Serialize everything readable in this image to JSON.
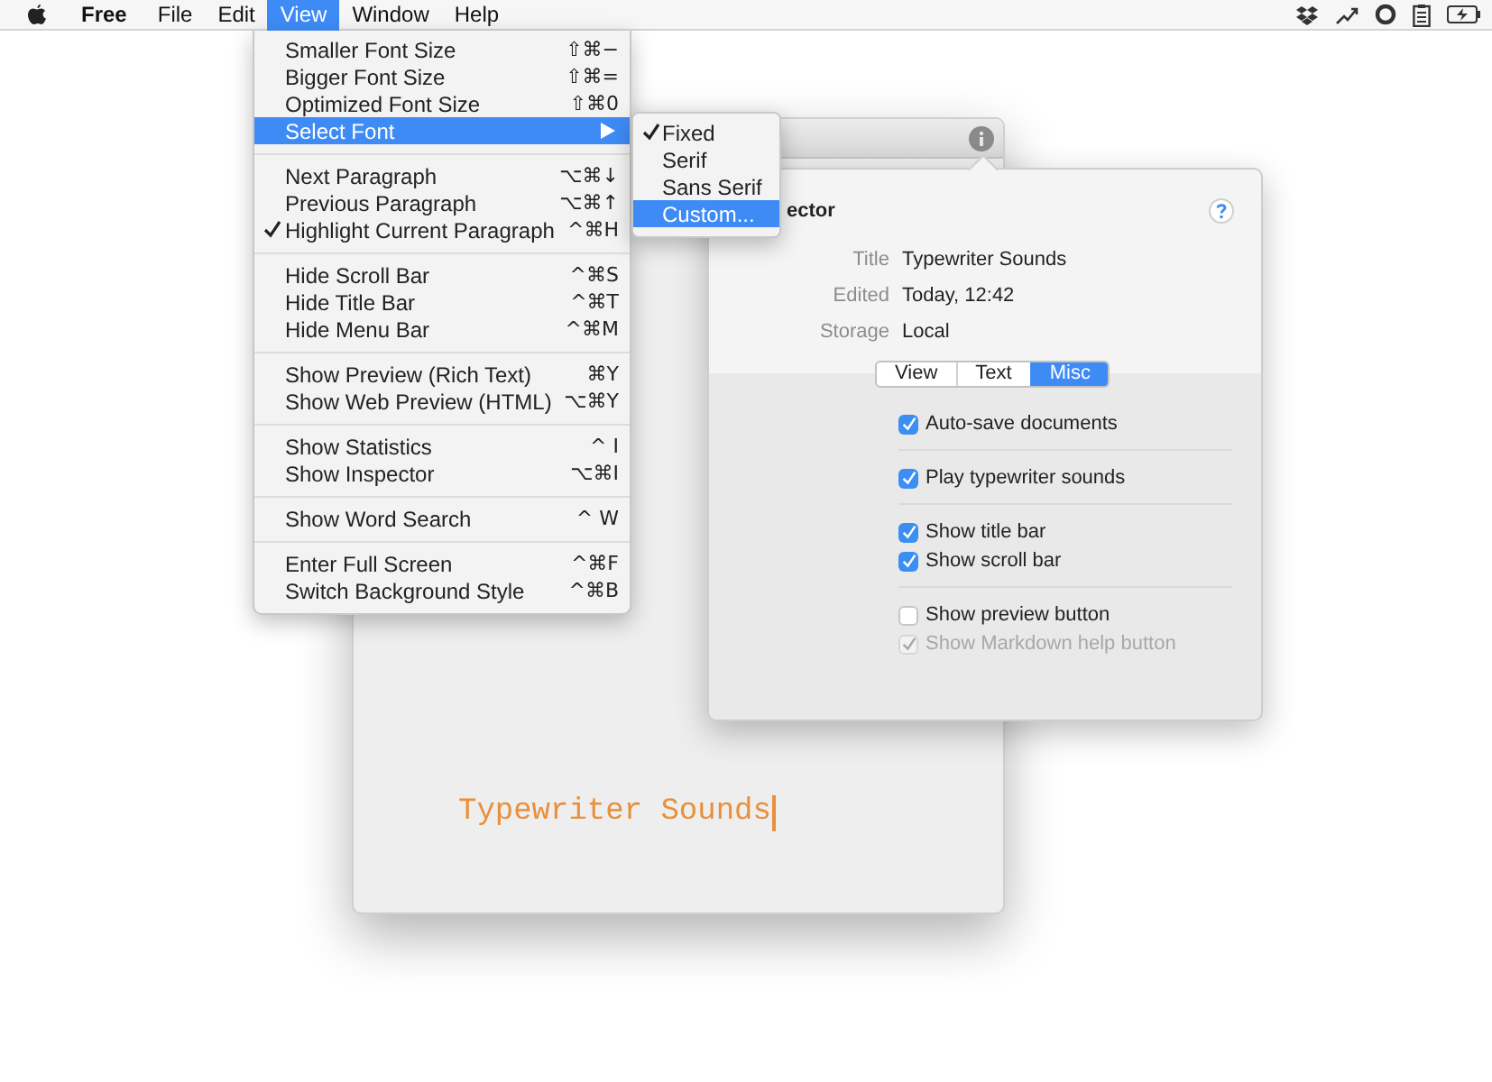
{
  "menu_bar": {
    "items": [
      {
        "label": "Free",
        "kind": "app",
        "selected": false
      },
      {
        "label": "File",
        "kind": "menu",
        "selected": false
      },
      {
        "label": "Edit",
        "kind": "menu",
        "selected": false
      },
      {
        "label": "View",
        "kind": "menu",
        "selected": true
      },
      {
        "label": "Window",
        "kind": "menu",
        "selected": false
      },
      {
        "label": "Help",
        "kind": "menu",
        "selected": false
      }
    ]
  },
  "view_menu": {
    "groups": [
      {
        "items": [
          {
            "label": "Smaller Font Size",
            "shortcut": "⇧⌘−",
            "checked": false,
            "selected": false
          },
          {
            "label": "Bigger Font Size",
            "shortcut": "⇧⌘=",
            "checked": false,
            "selected": false
          },
          {
            "label": "Optimized Font Size",
            "shortcut": "⇧⌘0",
            "checked": false,
            "selected": false
          },
          {
            "label": "Select Font",
            "checked": false,
            "selected": true,
            "submenu": {
              "items": [
                {
                  "label": "Fixed",
                  "checked": true,
                  "selected": false
                },
                {
                  "label": "Serif",
                  "checked": false,
                  "selected": false
                },
                {
                  "label": "Sans Serif",
                  "checked": false,
                  "selected": false
                },
                {
                  "label": "Custom...",
                  "checked": false,
                  "selected": true
                }
              ]
            }
          }
        ]
      },
      {
        "items": [
          {
            "label": "Next Paragraph",
            "shortcut": "⌥⌘↓",
            "checked": false,
            "selected": false
          },
          {
            "label": "Previous Paragraph",
            "shortcut": "⌥⌘↑",
            "checked": false,
            "selected": false
          },
          {
            "label": "Highlight Current Paragraph",
            "shortcut": "^⌘H",
            "checked": true,
            "selected": false
          }
        ]
      },
      {
        "items": [
          {
            "label": "Hide Scroll Bar",
            "shortcut": "^⌘S",
            "checked": false,
            "selected": false
          },
          {
            "label": "Hide Title Bar",
            "shortcut": "^⌘T",
            "checked": false,
            "selected": false
          },
          {
            "label": "Hide Menu Bar",
            "shortcut": "^⌘M",
            "checked": false,
            "selected": false
          }
        ]
      },
      {
        "items": [
          {
            "label": "Show Preview (Rich Text)",
            "shortcut": "⌘Y",
            "checked": false,
            "selected": false
          },
          {
            "label": "Show Web Preview (HTML)",
            "shortcut": "⌥⌘Y",
            "checked": false,
            "selected": false
          }
        ]
      },
      {
        "items": [
          {
            "label": "Show Statistics",
            "shortcut": "^ I",
            "checked": false,
            "selected": false
          },
          {
            "label": "Show Inspector",
            "shortcut": "⌥⌘I",
            "checked": false,
            "selected": false
          }
        ]
      },
      {
        "items": [
          {
            "label": "Show Word Search",
            "shortcut": "^ W",
            "checked": false,
            "selected": false
          }
        ]
      },
      {
        "items": [
          {
            "label": "Enter Full Screen",
            "shortcut": "^⌘F",
            "checked": false,
            "selected": false
          },
          {
            "label": "Switch Background Style",
            "shortcut": "^⌘B",
            "checked": false,
            "selected": false
          }
        ]
      }
    ]
  },
  "document": {
    "text": "Typewriter Sounds"
  },
  "inspector": {
    "title": "ector",
    "info": [
      {
        "label": "Title",
        "value": "Typewriter Sounds"
      },
      {
        "label": "Edited",
        "value": "Today, 12:42"
      },
      {
        "label": "Storage",
        "value": "Local"
      }
    ],
    "tabs": [
      {
        "label": "View",
        "selected": false
      },
      {
        "label": "Text",
        "selected": false
      },
      {
        "label": "Misc",
        "selected": true
      }
    ],
    "option_groups": [
      {
        "options": [
          {
            "label": "Auto-save documents",
            "checked": true,
            "disabled": false
          }
        ]
      },
      {
        "options": [
          {
            "label": "Play typewriter sounds",
            "checked": true,
            "disabled": false
          }
        ]
      },
      {
        "options": [
          {
            "label": "Show title bar",
            "checked": true,
            "disabled": false
          },
          {
            "label": "Show scroll bar",
            "checked": true,
            "disabled": false
          }
        ]
      },
      {
        "options": [
          {
            "label": "Show preview button",
            "checked": false,
            "disabled": false
          },
          {
            "label": "Show Markdown help button",
            "checked": true,
            "disabled": true
          }
        ]
      }
    ]
  }
}
